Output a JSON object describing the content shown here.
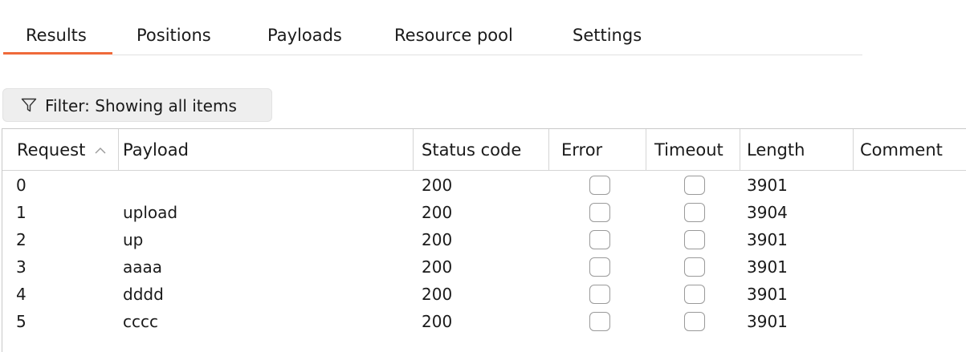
{
  "tabs": [
    {
      "label": "Results",
      "active": true
    },
    {
      "label": "Positions"
    },
    {
      "label": "Payloads"
    },
    {
      "label": "Resource pool"
    },
    {
      "label": "Settings"
    }
  ],
  "accent_color": "#ef6a3a",
  "filter": {
    "label": "Filter: Showing all items",
    "icon": "funnel-icon"
  },
  "table": {
    "columns": [
      "Request",
      "Payload",
      "Status code",
      "Error",
      "Timeout",
      "Length",
      "Comment"
    ],
    "sort": {
      "column": "Request",
      "direction": "ascending",
      "icon": "chevron-up-icon"
    },
    "rows": [
      {
        "request": "0",
        "payload": "",
        "status": "200",
        "error": false,
        "timeout": false,
        "length": "3901",
        "comment": ""
      },
      {
        "request": "1",
        "payload": "upload",
        "status": "200",
        "error": false,
        "timeout": false,
        "length": "3904",
        "comment": ""
      },
      {
        "request": "2",
        "payload": "up",
        "status": "200",
        "error": false,
        "timeout": false,
        "length": "3901",
        "comment": ""
      },
      {
        "request": "3",
        "payload": "aaaa",
        "status": "200",
        "error": false,
        "timeout": false,
        "length": "3901",
        "comment": ""
      },
      {
        "request": "4",
        "payload": "dddd",
        "status": "200",
        "error": false,
        "timeout": false,
        "length": "3901",
        "comment": ""
      },
      {
        "request": "5",
        "payload": "cccc",
        "status": "200",
        "error": false,
        "timeout": false,
        "length": "3901",
        "comment": ""
      }
    ]
  }
}
